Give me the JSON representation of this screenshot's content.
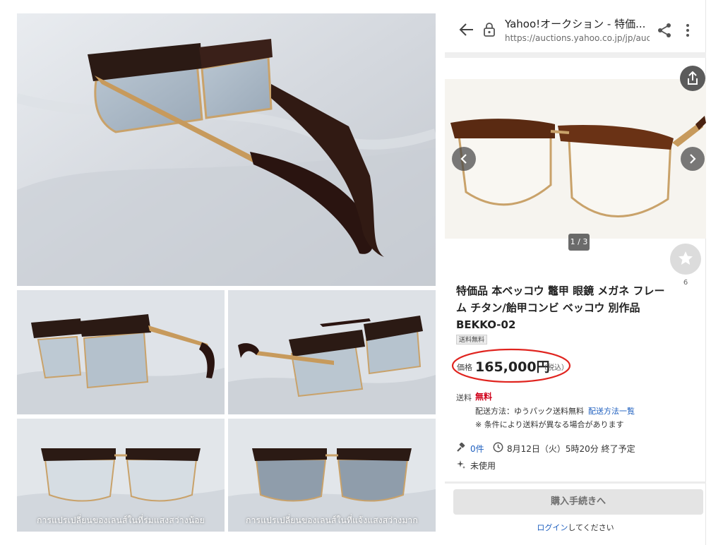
{
  "captions": {
    "low_light": "การแปรเปลี่ยนของเลนส์ในที่ร่มแสงสว่างน้อย",
    "bright_light": "การแปรเปลี่ยนของเลนส์ในที่แจ้งแสงสว่างมาก"
  },
  "browser": {
    "title": "Yahoo!オークション - 特価...",
    "url": "https://auctions.yahoo.co.jp/jp/auct"
  },
  "gallery": {
    "counter": "1 / 3"
  },
  "watch": {
    "count": "6"
  },
  "item": {
    "title": "特価品 本ベッコウ 鼈甲 眼鏡 メガネ フレーム チタン/飴甲コンビ ベッコウ 別作品　BEKKO-02",
    "badge": "送料無料",
    "price_label": "価格",
    "price": "165,000円",
    "tax_note": "（税込）"
  },
  "shipping": {
    "label": "送料",
    "value": "無料",
    "method": "配送方法：ゆうパック送料無料",
    "method_link": "配送方法一覧",
    "note": "※ 条件により送料が異なる場合があります"
  },
  "meta": {
    "bids": "0件",
    "end_time": "8月12日（火）5時20分 終了予定",
    "condition": "未使用"
  },
  "actions": {
    "buy_button": "購入手続きへ",
    "login_link": "ログイン",
    "login_suffix": "してください"
  },
  "colors": {
    "accent_link": "#1e5fbf",
    "free_red": "#d0021b",
    "price_circle": "#e0241f"
  }
}
